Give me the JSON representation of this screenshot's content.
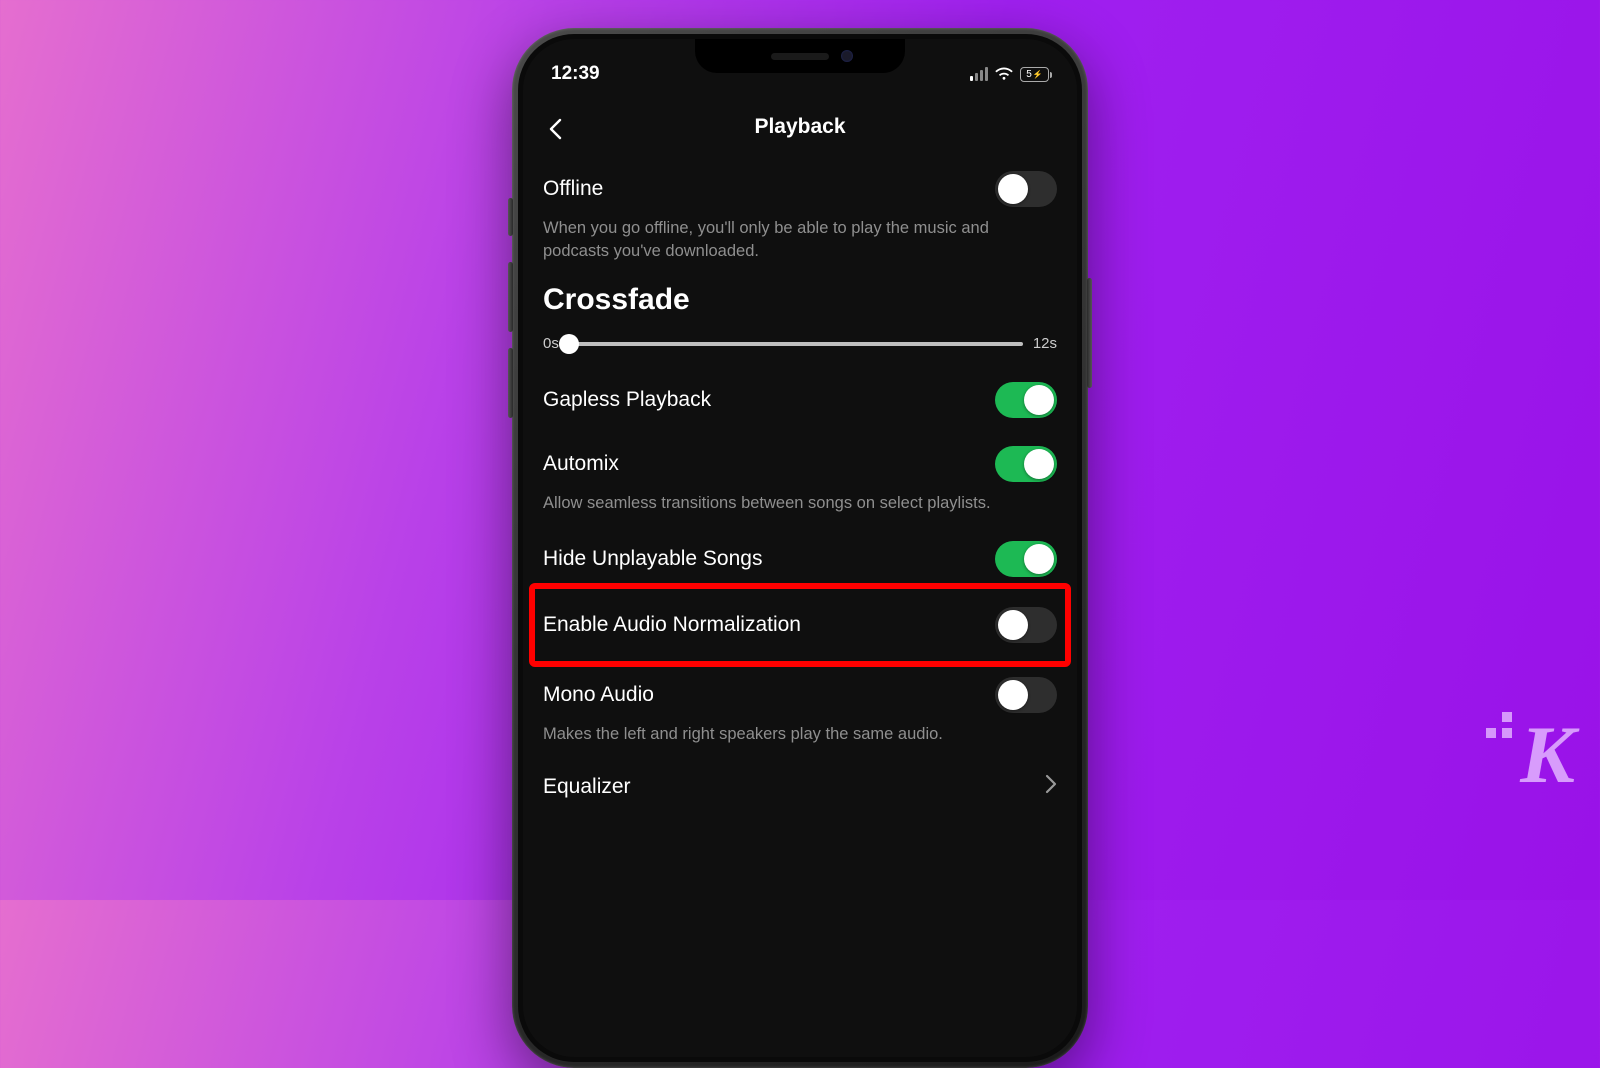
{
  "status": {
    "time": "12:39",
    "battery_text": "5"
  },
  "header": {
    "title": "Playback"
  },
  "offline": {
    "label": "Offline",
    "description": "When you go offline, you'll only be able to play the music and podcasts you've downloaded.",
    "enabled": false
  },
  "crossfade": {
    "title": "Crossfade",
    "min_label": "0s",
    "max_label": "12s"
  },
  "gapless": {
    "label": "Gapless Playback",
    "enabled": true
  },
  "automix": {
    "label": "Automix",
    "description": "Allow seamless transitions between songs on select playlists.",
    "enabled": true
  },
  "hide_unplayable": {
    "label": "Hide Unplayable Songs",
    "enabled": true
  },
  "normalization": {
    "label": "Enable Audio Normalization",
    "enabled": false
  },
  "mono": {
    "label": "Mono Audio",
    "description": "Makes the left and right speakers play the same audio.",
    "enabled": false
  },
  "equalizer": {
    "label": "Equalizer"
  },
  "watermark": "K"
}
